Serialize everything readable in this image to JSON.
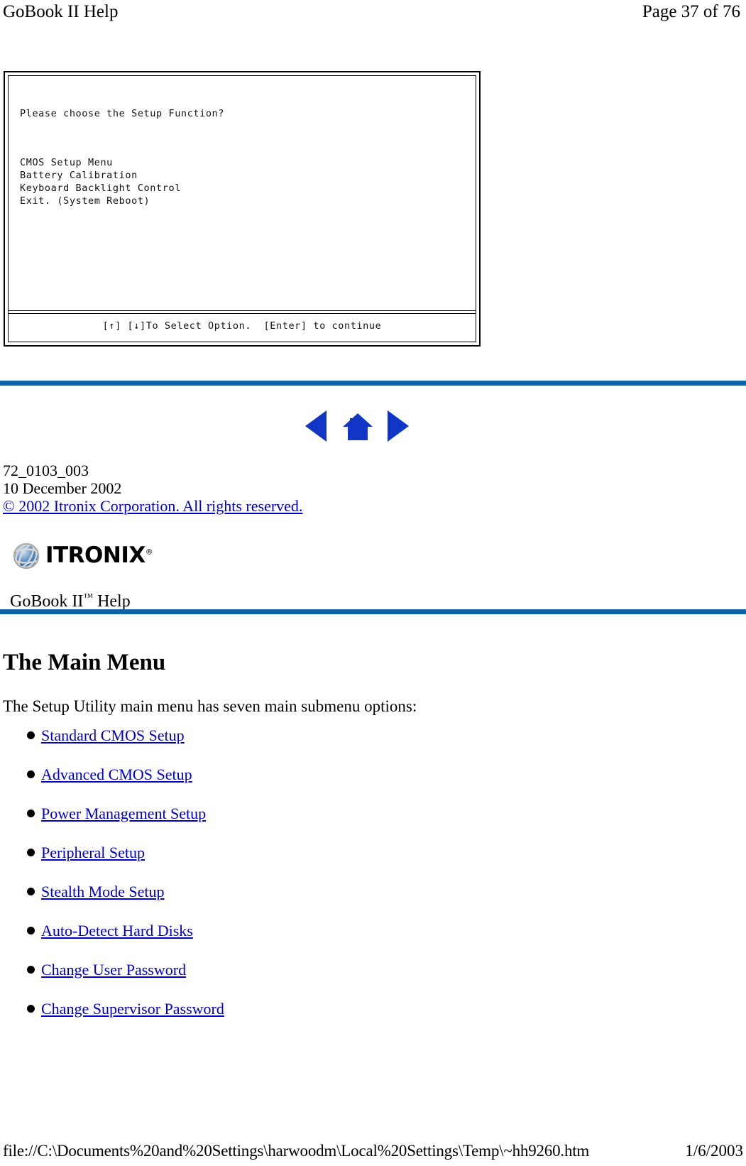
{
  "header": {
    "doc_title": "GoBook II Help",
    "page_indicator": "Page 37 of 76"
  },
  "bios_screen": {
    "prompt": "Please choose the Setup Function?",
    "menu_items": [
      "CMOS Setup Menu",
      "Battery Calibration",
      "Keyboard Backlight Control",
      "Exit. (System Reboot)"
    ],
    "footer_hint": "[↑] [↓]To Select Option.  [Enter] to continue"
  },
  "navigation": {
    "back_icon": "left-arrow-icon",
    "home_icon": "home-icon",
    "forward_icon": "right-arrow-icon"
  },
  "document_info": {
    "doc_number": "72_0103_003",
    "doc_date": "10 December 2002",
    "copyright_link": "© 2002 Itronix Corporation.  All rights reserved."
  },
  "branding": {
    "logo_text": "ITRONIX",
    "logo_registered": "®",
    "globe_icon": "globe-icon",
    "help_title_main": "GoBook II",
    "help_title_tm": "™",
    "help_title_suffix": " Help"
  },
  "main": {
    "title": "The Main Menu",
    "intro": "The Setup Utility main menu has seven main submenu options:",
    "options": [
      "Standard CMOS Setup",
      "Advanced CMOS Setup",
      "Power Management Setup",
      "Peripheral Setup",
      "Stealth Mode Setup",
      "Auto-Detect Hard Disks",
      "Change User Password",
      "Change Supervisor Password"
    ]
  },
  "footer": {
    "file_path": "file://C:\\Documents%20and%20Settings\\harwoodm\\Local%20Settings\\Temp\\~hh9260.htm",
    "print_date": "1/6/2003"
  },
  "colors": {
    "rule_blue": "#0b63a8",
    "link_blue": "#0000cc",
    "icon_blue": "#1135c4"
  }
}
